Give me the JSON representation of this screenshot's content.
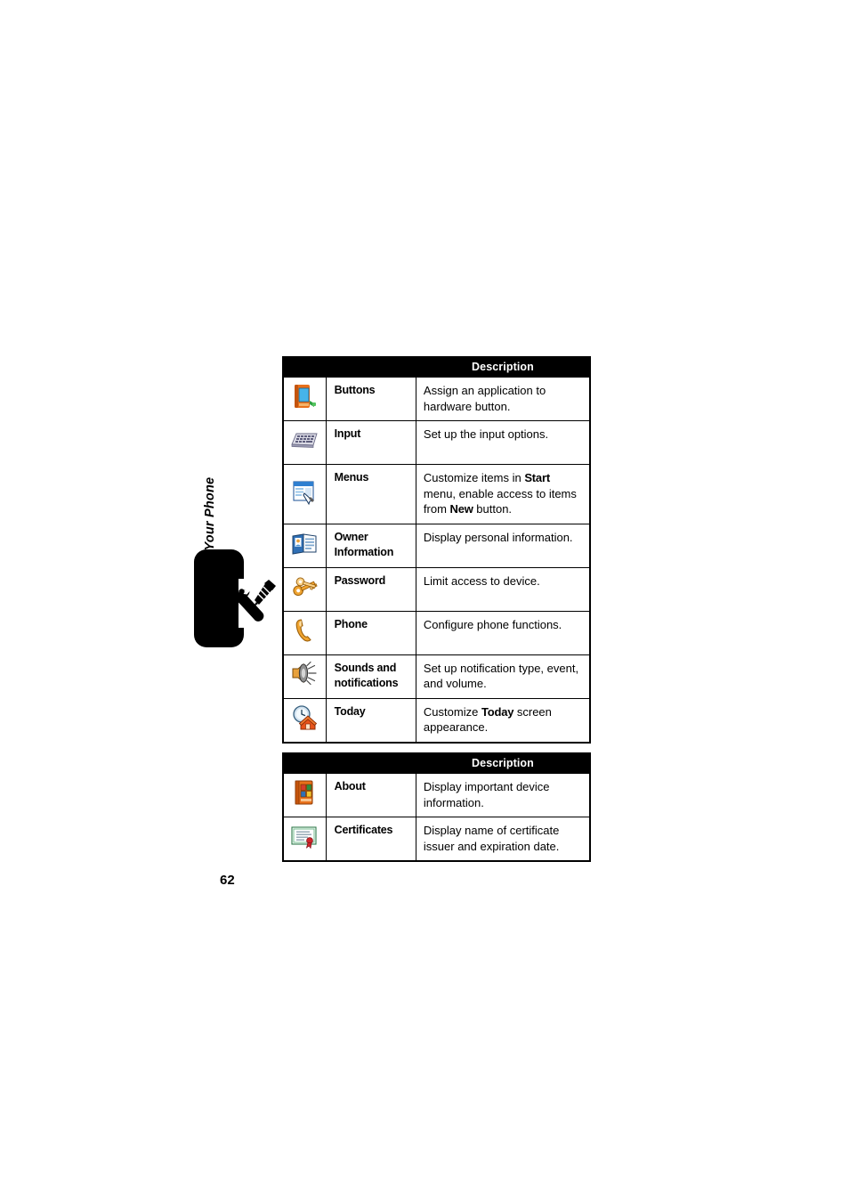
{
  "page": {
    "number": "62",
    "chapter_label": "Setting Up Your Phone",
    "tab_icon": "wrench-screwdriver-icon"
  },
  "tables": [
    {
      "id": "settings-table",
      "header": {
        "icon_col": "",
        "name_col": "",
        "description_col": "Description"
      },
      "rows": [
        {
          "icon": "pda-device-icon",
          "name": "Buttons",
          "description_parts": [
            {
              "text": "Assign an application to hardware button.",
              "bold": false
            }
          ],
          "description": "Assign an application to hardware button."
        },
        {
          "icon": "keyboard-icon",
          "name": "Input",
          "description_parts": [
            {
              "text": "Set up the input options.",
              "bold": false
            }
          ],
          "description": "Set up the input options."
        },
        {
          "icon": "menu-window-icon",
          "name": "Menus",
          "description_parts": [
            {
              "text": "Customize items in ",
              "bold": false
            },
            {
              "text": "Start",
              "bold": true
            },
            {
              "text": " menu, enable access to items from ",
              "bold": false
            },
            {
              "text": "New",
              "bold": true
            },
            {
              "text": " button.",
              "bold": false
            }
          ],
          "description": "Customize items in Start menu, enable access to items from New button."
        },
        {
          "icon": "id-card-icon",
          "name": "Owner Information",
          "description_parts": [
            {
              "text": "Display personal information.",
              "bold": false
            }
          ],
          "description": "Display personal information."
        },
        {
          "icon": "keys-icon",
          "name": "Password",
          "description_parts": [
            {
              "text": "Limit access to device.",
              "bold": false
            }
          ],
          "description": "Limit access to device."
        },
        {
          "icon": "phone-handset-icon",
          "name": "Phone",
          "description_parts": [
            {
              "text": "Configure phone functions.",
              "bold": false
            }
          ],
          "description": "Configure phone functions."
        },
        {
          "icon": "speaker-icon",
          "name": "Sounds and notifications",
          "description_parts": [
            {
              "text": "Set up notification type, event, and volume.",
              "bold": false
            }
          ],
          "description": "Set up notification type, event, and volume."
        },
        {
          "icon": "clock-house-icon",
          "name": "Today",
          "description_parts": [
            {
              "text": "Customize ",
              "bold": false
            },
            {
              "text": "Today",
              "bold": true
            },
            {
              "text": " screen appearance.",
              "bold": false
            }
          ],
          "description": "Customize Today screen appearance."
        }
      ]
    },
    {
      "id": "system-table",
      "header": {
        "icon_col": "",
        "name_col": "",
        "description_col": "Description"
      },
      "rows": [
        {
          "icon": "about-book-icon",
          "name": "About",
          "description_parts": [
            {
              "text": "Display important device information.",
              "bold": false
            }
          ],
          "description": "Display important device information."
        },
        {
          "icon": "certificate-icon",
          "name": "Certificates",
          "description_parts": [
            {
              "text": "Display name of certificate issuer and expiration date.",
              "bold": false
            }
          ],
          "description": "Display name of certificate issuer and expiration date."
        }
      ]
    }
  ],
  "colors": {
    "table_border": "#000000",
    "header_background": "#000000",
    "header_text": "#ffffff",
    "page_background": "#ffffff",
    "tab_background": "#000000"
  }
}
